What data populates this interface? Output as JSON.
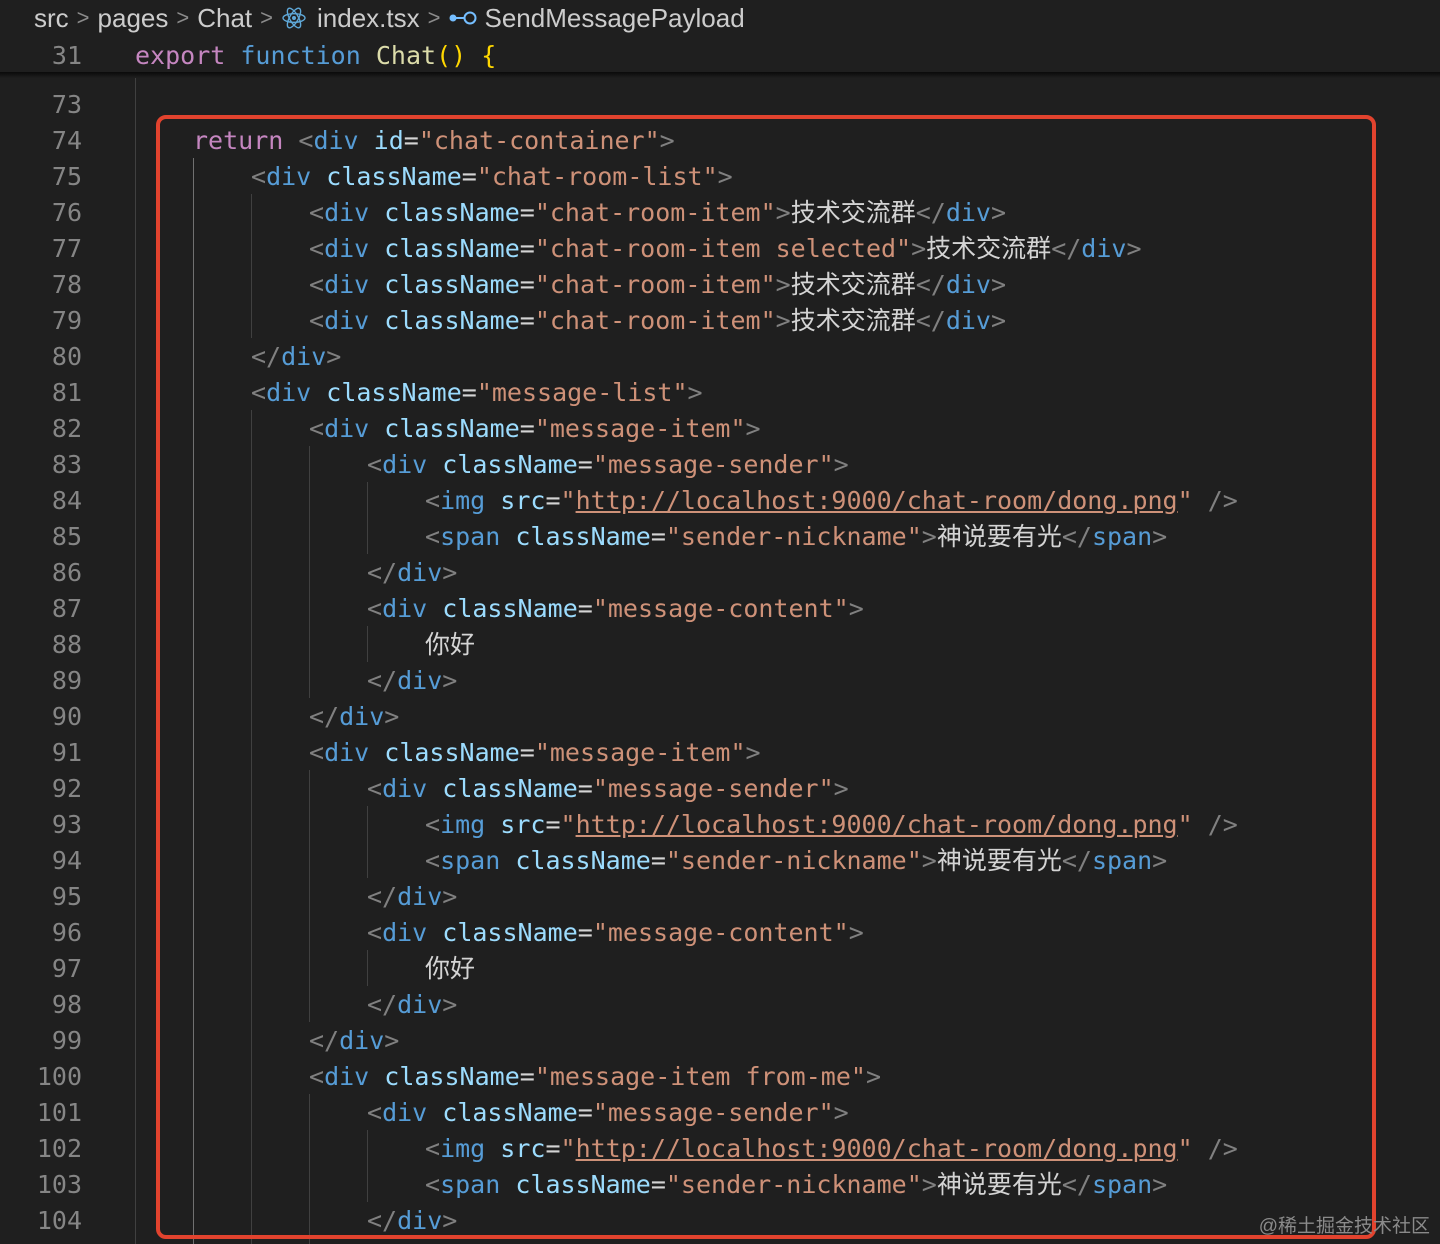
{
  "breadcrumb": {
    "items": [
      "src",
      "pages",
      "Chat",
      "index.tsx",
      "SendMessagePayload"
    ],
    "separator": ">"
  },
  "sticky": {
    "line_number": "31",
    "keyword_export": "export",
    "keyword_function": "function",
    "function_name": "Chat",
    "parens": "()",
    "open_brace": "{"
  },
  "line_numbers": [
    "73",
    "74",
    "75",
    "76",
    "77",
    "78",
    "79",
    "80",
    "81",
    "82",
    "83",
    "84",
    "85",
    "86",
    "87",
    "88",
    "89",
    "90",
    "91",
    "92",
    "93",
    "94",
    "95",
    "96",
    "97",
    "98",
    "99",
    "100",
    "101",
    "102",
    "103",
    "104"
  ],
  "code": {
    "return_kw": "return",
    "div": "div",
    "img": "img",
    "span": "span",
    "id_attr": "id",
    "class_attr": "className",
    "src_attr": "src",
    "chat_container": "\"chat-container\"",
    "chat_room_list": "\"chat-room-list\"",
    "chat_room_item": "\"chat-room-item\"",
    "chat_room_item_selected": "\"chat-room-item selected\"",
    "room_name": "技术交流群",
    "message_list": "\"message-list\"",
    "message_item": "\"message-item\"",
    "message_item_from_me": "\"message-item from-me\"",
    "message_sender": "\"message-sender\"",
    "message_content": "\"message-content\"",
    "sender_nickname": "\"sender-nickname\"",
    "img_url": "http://localhost:9000/chat-room/dong.png",
    "nickname": "神说要有光",
    "content_text": "你好"
  },
  "colors": {
    "highlight_box": "#e2432e",
    "background": "#1f1f1f"
  },
  "watermark": "@稀土掘金技术社区"
}
